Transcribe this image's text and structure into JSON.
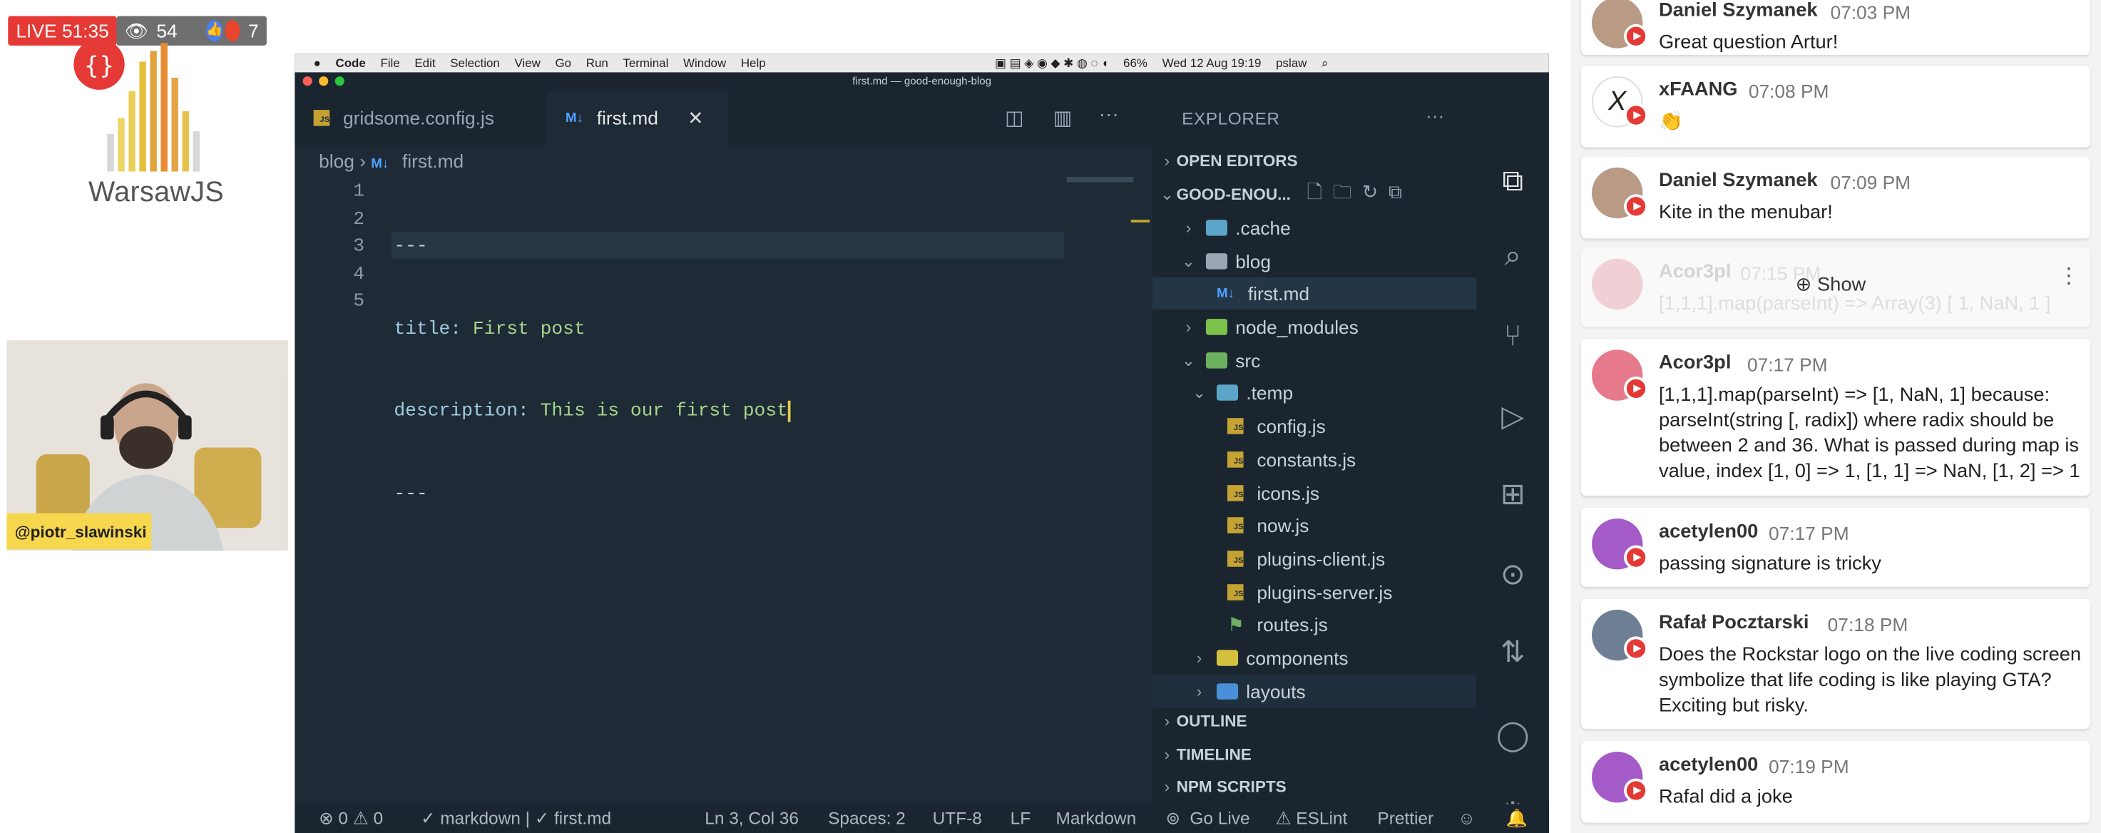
{
  "stream": {
    "live_label": "LIVE 51:35",
    "viewers": "54",
    "reactions": "7",
    "brand": "WarsawJS",
    "logo_glyph": "{}",
    "presenter_handle": "@piotr_slawinski"
  },
  "macos_menu": {
    "items": [
      "Code",
      "File",
      "Edit",
      "Selection",
      "View",
      "Go",
      "Run",
      "Terminal",
      "Window",
      "Help"
    ],
    "right_status": [
      "66%",
      "Wed 12 Aug 19:19",
      "pslaw"
    ]
  },
  "vscode": {
    "window_title": "first.md — good-enough-blog",
    "tabs": [
      {
        "label": "gridsome.config.js",
        "icon": "js-file-icon"
      },
      {
        "label": "first.md",
        "icon": "markdown-file-icon",
        "close": "✕"
      }
    ],
    "breadcrumb": [
      "blog",
      "first.md"
    ],
    "line_numbers": [
      "1",
      "2",
      "3",
      "4",
      "5"
    ],
    "code": {
      "l1": "---",
      "l2_key": "title:",
      "l2_val": " First post",
      "l3_key": "description:",
      "l3_val": " This is our first post",
      "l4": "---"
    },
    "explorer": {
      "title": "EXPLORER",
      "open_editors": "OPEN EDITORS",
      "project": "GOOD-ENOU...",
      "tree": [
        ".cache",
        "blog",
        "first.md",
        "node_modules",
        "src",
        ".temp",
        "config.js",
        "constants.js",
        "icons.js",
        "now.js",
        "plugins-client.js",
        "plugins-server.js",
        "routes.js",
        "components",
        "layouts"
      ],
      "sections": [
        "OUTLINE",
        "TIMELINE",
        "NPM SCRIPTS"
      ]
    },
    "status": {
      "problems": "⊗ 0 ⚠ 0",
      "lint": "✓ markdown | ✓ first.md",
      "position": "Ln 3, Col 36",
      "spaces": "Spaces: 2",
      "encoding": "UTF-8",
      "eol": "LF",
      "language": "Markdown",
      "golive": "Go Live",
      "eslint": "⚠ ESLint",
      "prettier": "Prettier"
    }
  },
  "chat": {
    "messages": [
      {
        "name": "Daniel Szymanek",
        "time": "07:03 PM",
        "text": "Great question Artur!"
      },
      {
        "name": "xFAANG",
        "time": "07:08 PM",
        "text": "👏"
      },
      {
        "name": "Daniel Szymanek",
        "time": "07:09 PM",
        "text": "Kite in the menubar!"
      },
      {
        "name": "Acor3pl",
        "time": "07:15 PM",
        "text": "[1,1,1].map(parseInt) => Array(3) [ 1, NaN, 1 ]",
        "show": "Show"
      },
      {
        "name": "Acor3pl",
        "time": "07:17 PM",
        "text": "[1,1,1].map(parseInt) => [1, NaN, 1] because: parseInt(string [, radix]) where radix should be between 2 and 36. What is passed during map is value, index [1, 0] => 1, [1, 1] => NaN, [1, 2] => 1"
      },
      {
        "name": "acetylen00",
        "time": "07:17 PM",
        "text": "passing signature is tricky"
      },
      {
        "name": "Rafał Pocztarski",
        "time": "07:18 PM",
        "text": "Does the Rockstar logo on the live coding screen symbolize that life coding is like playing GTA? Exciting but risky."
      },
      {
        "name": "acetylen00",
        "time": "07:19 PM",
        "text": "Rafal did a joke"
      }
    ]
  },
  "colors": {
    "live_red": "#e53935",
    "editor_bg": "#1e2a35",
    "sidebar_bg": "#1a2530",
    "string_green": "#a7d48c",
    "handle_yellow": "#f7d74d"
  }
}
